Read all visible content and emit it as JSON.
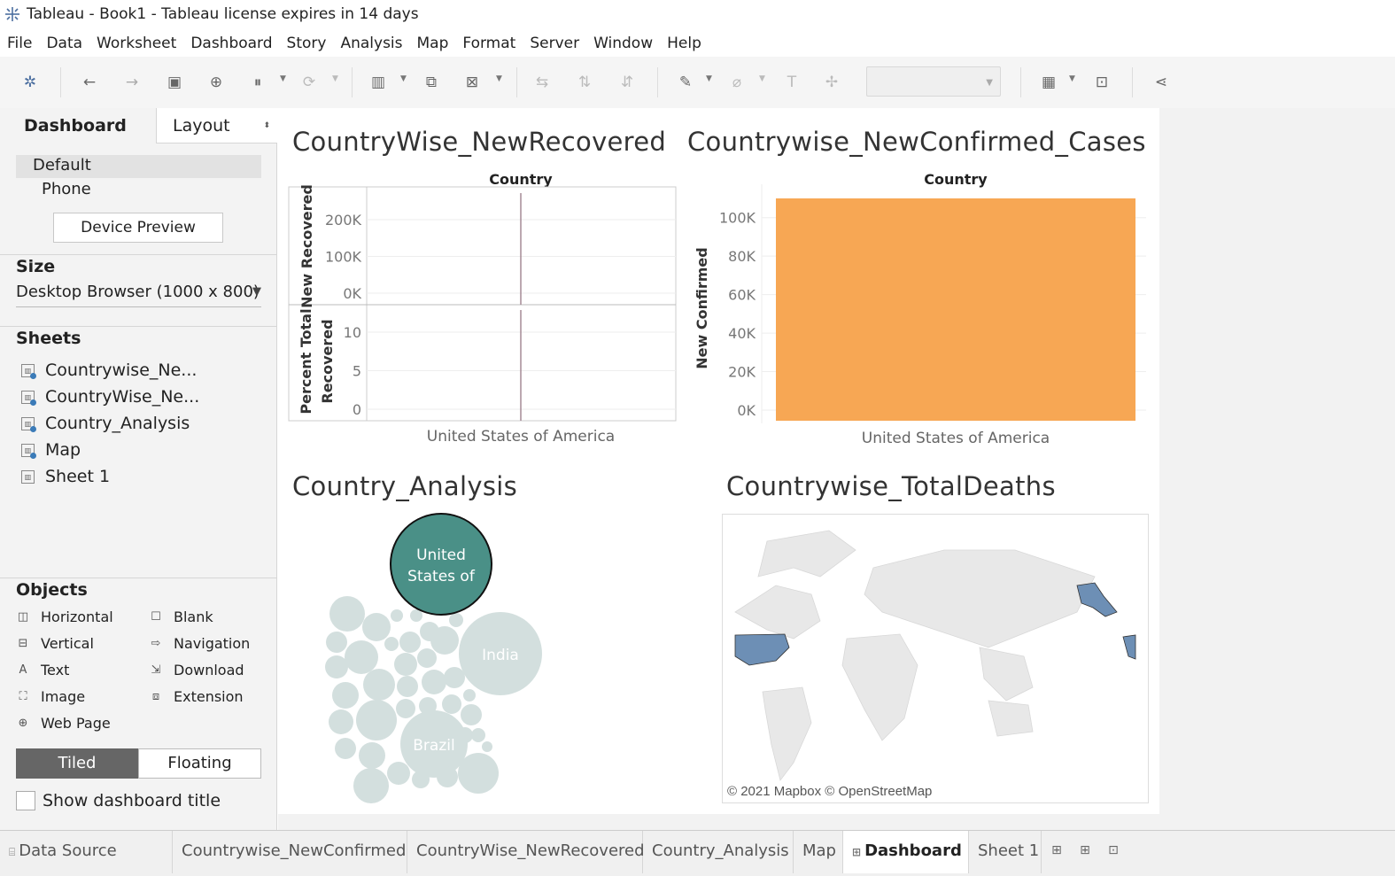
{
  "window": {
    "title": "Tableau - Book1 - Tableau license expires in 14 days"
  },
  "menu": [
    "File",
    "Data",
    "Worksheet",
    "Dashboard",
    "Story",
    "Analysis",
    "Map",
    "Format",
    "Server",
    "Window",
    "Help"
  ],
  "toolbar": {
    "icons": [
      "tableau-logo-icon",
      "undo-icon",
      "redo-icon",
      "save-icon",
      "new-data-source-icon",
      "pause-updates-icon",
      "refresh-icon",
      "new-worksheet-icon",
      "duplicate-sheet-icon",
      "clear-sheet-icon",
      "swap-icon",
      "sort-ascending-icon",
      "sort-descending-icon",
      "highlight-icon",
      "group-icon",
      "labels-icon",
      "fix-axes-icon",
      "show-me-icon",
      "presentation-icon",
      "share-icon"
    ],
    "fit_select_value": ""
  },
  "left_panel": {
    "tab_dashboard": "Dashboard",
    "tab_layout": "Layout",
    "devices": [
      "Default",
      "Phone"
    ],
    "device_preview_button": "Device Preview",
    "size_title": "Size",
    "size_value": "Desktop Browser (1000 x 800)",
    "sheets_title": "Sheets",
    "sheets": [
      "Countrywise_Ne...",
      "CountryWise_Ne...",
      "Country_Analysis",
      "Map",
      "Sheet 1"
    ],
    "objects_title": "Objects",
    "objects_left": [
      "Horizontal",
      "Vertical",
      "Text",
      "Image",
      "Web Page"
    ],
    "objects_right": [
      "Blank",
      "Navigation",
      "Download",
      "Extension"
    ],
    "tiled": "Tiled",
    "floating": "Floating",
    "show_title_label": "Show dashboard title"
  },
  "dashboard": {
    "recovered": {
      "title": "CountryWise_NewRecovered",
      "column_header": "Country",
      "x_label": "United States of America",
      "top_axis": "New Recovered",
      "bottom_axis": "Percent Total Recovered",
      "top_ticks": [
        "200K",
        "100K",
        "0K"
      ],
      "bottom_ticks": [
        "10",
        "5",
        "0"
      ]
    },
    "confirmed": {
      "title": "Countrywise_NewConfirmed_Cases",
      "column_header": "Country",
      "x_label": "United States of America",
      "y_axis": "New Confirmed",
      "ticks": [
        "100K",
        "80K",
        "60K",
        "40K",
        "20K",
        "0K"
      ],
      "bar_color": "#f7a754"
    },
    "analysis": {
      "title": "Country_Analysis",
      "bubble_main_label": "United States of",
      "bubble_india": "India",
      "bubble_brazil": "Brazil",
      "main_color": "#4a9087",
      "bg_color": "#d3dfde"
    },
    "deaths": {
      "title": "Countrywise_TotalDeaths",
      "attribution": "© 2021 Mapbox © OpenStreetMap",
      "highlight_color": "#6d8fb5"
    }
  },
  "chart_data": [
    {
      "type": "bar",
      "title": "CountryWise_NewRecovered",
      "categories": [
        "United States of America"
      ],
      "series": [
        {
          "name": "New Recovered",
          "values": [
            0
          ]
        },
        {
          "name": "Percent Total Recovered",
          "values": [
            0
          ]
        }
      ],
      "ylim_new_recovered": [
        0,
        270000
      ],
      "ylim_percent": [
        0,
        11
      ],
      "ylabel": "New Recovered"
    },
    {
      "type": "bar",
      "title": "Countrywise_NewConfirmed_Cases",
      "categories": [
        "United States of America"
      ],
      "values": [
        110000
      ],
      "ylabel": "New Confirmed",
      "ylim": [
        0,
        110000
      ]
    }
  ],
  "bottom_tabs": [
    "Data Source",
    "Countrywise_NewConfirmed",
    "CountryWise_NewRecovered",
    "Country_Analysis",
    "Map",
    "Dashboard 1",
    "Sheet 1"
  ],
  "bottom_tab_active": "Dashboard 1",
  "bottom_icons": [
    "new-worksheet-icon",
    "new-dashboard-icon",
    "new-story-icon"
  ]
}
